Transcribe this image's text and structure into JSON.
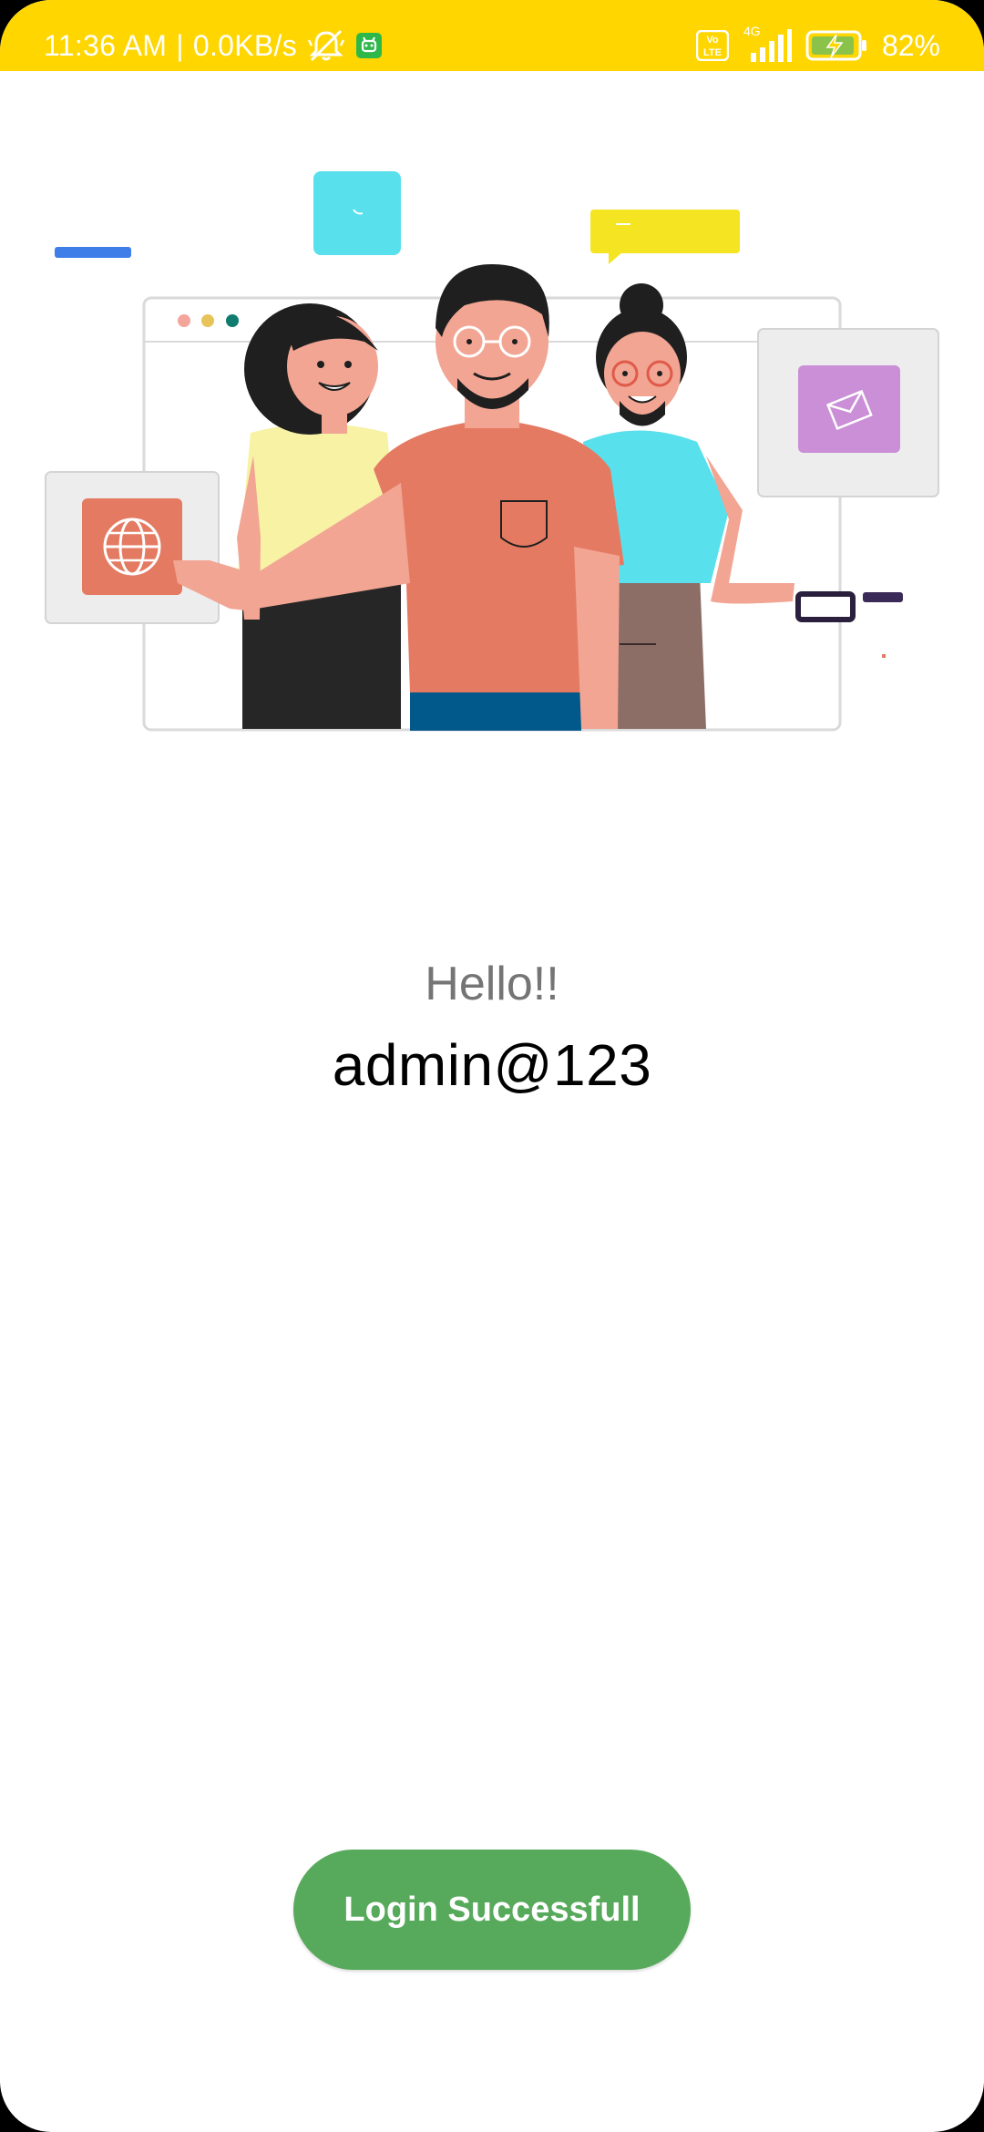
{
  "status_bar": {
    "time": "11:36 AM",
    "separator": "|",
    "network_speed": "0.0KB/s",
    "network_type": "4G",
    "volte_label": "Vo LTE",
    "battery_percent": "82%",
    "battery_level": 0.82,
    "icons": [
      "muted-bell-icon",
      "app-notification-icon",
      "volte-icon",
      "signal-icon",
      "battery-charging-icon"
    ]
  },
  "colors": {
    "status_bar_bg": "#FFD600",
    "button_bg": "#57AA5B",
    "greeting_text": "#757575",
    "username_text": "#000000"
  },
  "main": {
    "greeting": "Hello!!",
    "username": "admin@123",
    "login_button_label": "Login Successfull"
  }
}
